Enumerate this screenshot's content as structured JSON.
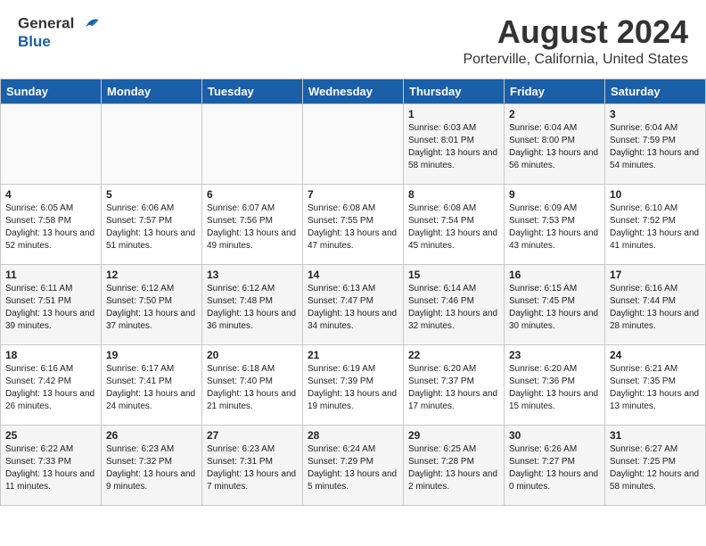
{
  "header": {
    "logo_line1": "General",
    "logo_line2": "Blue",
    "month_year": "August 2024",
    "location": "Porterville, California, United States"
  },
  "calendar": {
    "days_of_week": [
      "Sunday",
      "Monday",
      "Tuesday",
      "Wednesday",
      "Thursday",
      "Friday",
      "Saturday"
    ],
    "weeks": [
      [
        {
          "day": "",
          "sunrise": "",
          "sunset": "",
          "daylight": ""
        },
        {
          "day": "",
          "sunrise": "",
          "sunset": "",
          "daylight": ""
        },
        {
          "day": "",
          "sunrise": "",
          "sunset": "",
          "daylight": ""
        },
        {
          "day": "",
          "sunrise": "",
          "sunset": "",
          "daylight": ""
        },
        {
          "day": "1",
          "sunrise": "Sunrise: 6:03 AM",
          "sunset": "Sunset: 8:01 PM",
          "daylight": "Daylight: 13 hours and 58 minutes."
        },
        {
          "day": "2",
          "sunrise": "Sunrise: 6:04 AM",
          "sunset": "Sunset: 8:00 PM",
          "daylight": "Daylight: 13 hours and 56 minutes."
        },
        {
          "day": "3",
          "sunrise": "Sunrise: 6:04 AM",
          "sunset": "Sunset: 7:59 PM",
          "daylight": "Daylight: 13 hours and 54 minutes."
        }
      ],
      [
        {
          "day": "4",
          "sunrise": "Sunrise: 6:05 AM",
          "sunset": "Sunset: 7:58 PM",
          "daylight": "Daylight: 13 hours and 52 minutes."
        },
        {
          "day": "5",
          "sunrise": "Sunrise: 6:06 AM",
          "sunset": "Sunset: 7:57 PM",
          "daylight": "Daylight: 13 hours and 51 minutes."
        },
        {
          "day": "6",
          "sunrise": "Sunrise: 6:07 AM",
          "sunset": "Sunset: 7:56 PM",
          "daylight": "Daylight: 13 hours and 49 minutes."
        },
        {
          "day": "7",
          "sunrise": "Sunrise: 6:08 AM",
          "sunset": "Sunset: 7:55 PM",
          "daylight": "Daylight: 13 hours and 47 minutes."
        },
        {
          "day": "8",
          "sunrise": "Sunrise: 6:08 AM",
          "sunset": "Sunset: 7:54 PM",
          "daylight": "Daylight: 13 hours and 45 minutes."
        },
        {
          "day": "9",
          "sunrise": "Sunrise: 6:09 AM",
          "sunset": "Sunset: 7:53 PM",
          "daylight": "Daylight: 13 hours and 43 minutes."
        },
        {
          "day": "10",
          "sunrise": "Sunrise: 6:10 AM",
          "sunset": "Sunset: 7:52 PM",
          "daylight": "Daylight: 13 hours and 41 minutes."
        }
      ],
      [
        {
          "day": "11",
          "sunrise": "Sunrise: 6:11 AM",
          "sunset": "Sunset: 7:51 PM",
          "daylight": "Daylight: 13 hours and 39 minutes."
        },
        {
          "day": "12",
          "sunrise": "Sunrise: 6:12 AM",
          "sunset": "Sunset: 7:50 PM",
          "daylight": "Daylight: 13 hours and 37 minutes."
        },
        {
          "day": "13",
          "sunrise": "Sunrise: 6:12 AM",
          "sunset": "Sunset: 7:48 PM",
          "daylight": "Daylight: 13 hours and 36 minutes."
        },
        {
          "day": "14",
          "sunrise": "Sunrise: 6:13 AM",
          "sunset": "Sunset: 7:47 PM",
          "daylight": "Daylight: 13 hours and 34 minutes."
        },
        {
          "day": "15",
          "sunrise": "Sunrise: 6:14 AM",
          "sunset": "Sunset: 7:46 PM",
          "daylight": "Daylight: 13 hours and 32 minutes."
        },
        {
          "day": "16",
          "sunrise": "Sunrise: 6:15 AM",
          "sunset": "Sunset: 7:45 PM",
          "daylight": "Daylight: 13 hours and 30 minutes."
        },
        {
          "day": "17",
          "sunrise": "Sunrise: 6:16 AM",
          "sunset": "Sunset: 7:44 PM",
          "daylight": "Daylight: 13 hours and 28 minutes."
        }
      ],
      [
        {
          "day": "18",
          "sunrise": "Sunrise: 6:16 AM",
          "sunset": "Sunset: 7:42 PM",
          "daylight": "Daylight: 13 hours and 26 minutes."
        },
        {
          "day": "19",
          "sunrise": "Sunrise: 6:17 AM",
          "sunset": "Sunset: 7:41 PM",
          "daylight": "Daylight: 13 hours and 24 minutes."
        },
        {
          "day": "20",
          "sunrise": "Sunrise: 6:18 AM",
          "sunset": "Sunset: 7:40 PM",
          "daylight": "Daylight: 13 hours and 21 minutes."
        },
        {
          "day": "21",
          "sunrise": "Sunrise: 6:19 AM",
          "sunset": "Sunset: 7:39 PM",
          "daylight": "Daylight: 13 hours and 19 minutes."
        },
        {
          "day": "22",
          "sunrise": "Sunrise: 6:20 AM",
          "sunset": "Sunset: 7:37 PM",
          "daylight": "Daylight: 13 hours and 17 minutes."
        },
        {
          "day": "23",
          "sunrise": "Sunrise: 6:20 AM",
          "sunset": "Sunset: 7:36 PM",
          "daylight": "Daylight: 13 hours and 15 minutes."
        },
        {
          "day": "24",
          "sunrise": "Sunrise: 6:21 AM",
          "sunset": "Sunset: 7:35 PM",
          "daylight": "Daylight: 13 hours and 13 minutes."
        }
      ],
      [
        {
          "day": "25",
          "sunrise": "Sunrise: 6:22 AM",
          "sunset": "Sunset: 7:33 PM",
          "daylight": "Daylight: 13 hours and 11 minutes."
        },
        {
          "day": "26",
          "sunrise": "Sunrise: 6:23 AM",
          "sunset": "Sunset: 7:32 PM",
          "daylight": "Daylight: 13 hours and 9 minutes."
        },
        {
          "day": "27",
          "sunrise": "Sunrise: 6:23 AM",
          "sunset": "Sunset: 7:31 PM",
          "daylight": "Daylight: 13 hours and 7 minutes."
        },
        {
          "day": "28",
          "sunrise": "Sunrise: 6:24 AM",
          "sunset": "Sunset: 7:29 PM",
          "daylight": "Daylight: 13 hours and 5 minutes."
        },
        {
          "day": "29",
          "sunrise": "Sunrise: 6:25 AM",
          "sunset": "Sunset: 7:28 PM",
          "daylight": "Daylight: 13 hours and 2 minutes."
        },
        {
          "day": "30",
          "sunrise": "Sunrise: 6:26 AM",
          "sunset": "Sunset: 7:27 PM",
          "daylight": "Daylight: 13 hours and 0 minutes."
        },
        {
          "day": "31",
          "sunrise": "Sunrise: 6:27 AM",
          "sunset": "Sunset: 7:25 PM",
          "daylight": "Daylight: 12 hours and 58 minutes."
        }
      ]
    ]
  }
}
